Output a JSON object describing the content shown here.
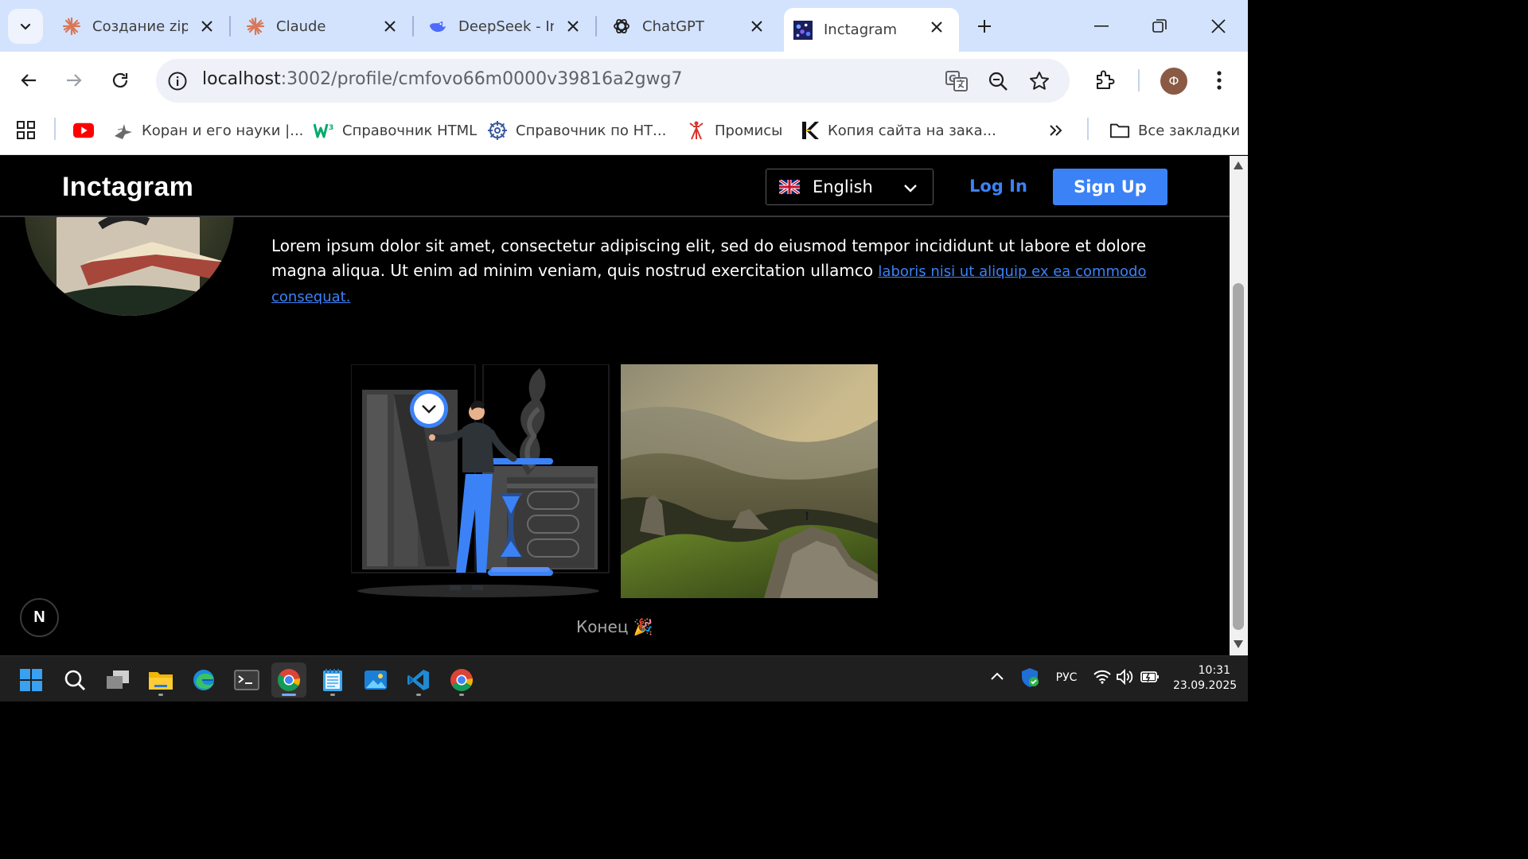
{
  "browser": {
    "tabs": [
      {
        "title": "Создание zip",
        "icon": "claude-icon"
      },
      {
        "title": "Claude",
        "icon": "claude-icon"
      },
      {
        "title": "DeepSeek - In",
        "icon": "deepseek-icon"
      },
      {
        "title": "ChatGPT",
        "icon": "chatgpt-icon"
      },
      {
        "title": "Inctagram",
        "icon": "inctagram-icon",
        "active": true
      }
    ],
    "url_host": "localhost",
    "url_rest": ":3002/profile/cmfovo66m0000v39816a2gwg7",
    "profile_initial": "Ф",
    "bookmarks": [
      {
        "label": "",
        "icon": "youtube-icon"
      },
      {
        "label": "Коран и его науки |...",
        "icon": "bird-icon"
      },
      {
        "label": "Справочник HTML",
        "icon": "w3-icon"
      },
      {
        "label": "Справочник по НТ...",
        "icon": "gear-wheel-icon"
      },
      {
        "label": "Промисы",
        "icon": "tower-icon"
      },
      {
        "label": "Копия сайта на зака...",
        "icon": "k-logo-icon"
      }
    ],
    "all_bookmarks_label": "Все закладки"
  },
  "site": {
    "logo": "Inctagram",
    "language": "English",
    "login_label": "Log In",
    "signup_label": "Sign Up",
    "bio_text": "Lorem ipsum dolor sit amet, consectetur adipiscing elit, sed do eiusmod tempor incididunt ut labore et dolore magna aliqua. Ut enim ad minim veniam, quis nostrud exercitation ullamco ",
    "bio_link": "laboris nisi ut aliquip ex ea commodo consequat.",
    "end_text": "Конец 🎉",
    "next_badge": "N"
  },
  "taskbar": {
    "language": "РУС",
    "time": "10:31",
    "date": "23.09.2025"
  },
  "colors": {
    "accent": "#3b82f6",
    "tabstrip": "#d3e3fd",
    "page_bg": "#000000"
  }
}
